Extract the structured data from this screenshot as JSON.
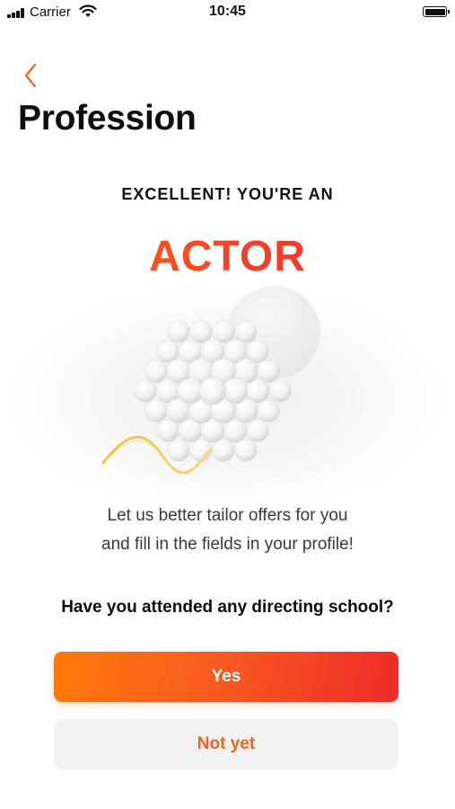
{
  "status_bar": {
    "carrier": "Carrier",
    "time": "10:45"
  },
  "header": {
    "back_icon": "chevron-left-icon",
    "title": "Profession"
  },
  "result": {
    "subtitle": "EXCELLENT! YOU'RE AN",
    "profession": "ACTOR"
  },
  "message": {
    "line1": "Let us better tailor offers for you",
    "line2": "and fill in the fields in your profile!"
  },
  "question": "Have you attended any directing school?",
  "buttons": {
    "yes_label": "Yes",
    "no_label": "Not yet"
  },
  "colors": {
    "accent_start": "#ff7a0a",
    "accent_end": "#ee2a2a",
    "secondary_button_bg": "#f1f1f1",
    "secondary_button_text": "#f26419"
  }
}
